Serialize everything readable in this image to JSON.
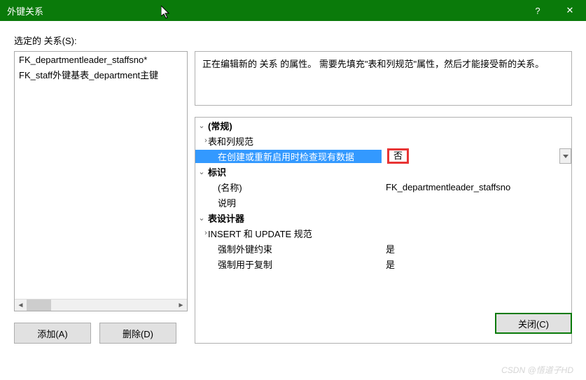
{
  "titlebar": {
    "title": "外键关系",
    "help": "?",
    "close": "✕"
  },
  "left_panel": {
    "label": "选定的 关系(S):",
    "items": [
      "FK_departmentleader_staffsno*",
      "FK_staff外键基表_department主键"
    ],
    "add_btn": "添加(A)",
    "delete_btn": "删除(D)"
  },
  "right_panel": {
    "description": "正在编辑新的 关系 的属性。    需要先填充\"表和列规范\"属性，然后才能接受新的关系。",
    "categories": {
      "general": "(常规)",
      "identity": "标识",
      "designer": "表设计器"
    },
    "props": {
      "table_col_spec": "表和列规范",
      "check_existing": {
        "name": "在创建或重新启用时检查现有数据",
        "value": "否"
      },
      "name": {
        "name": "(名称)",
        "value": "FK_departmentleader_staffsno"
      },
      "desc": {
        "name": "说明",
        "value": ""
      },
      "insert_update": "INSERT 和 UPDATE 规范",
      "enforce_fk": {
        "name": "强制外键约束",
        "value": "是"
      },
      "enforce_repl": {
        "name": "强制用于复制",
        "value": "是"
      }
    }
  },
  "close_btn": "关闭(C)",
  "watermark": "CSDN @悟道子HD"
}
